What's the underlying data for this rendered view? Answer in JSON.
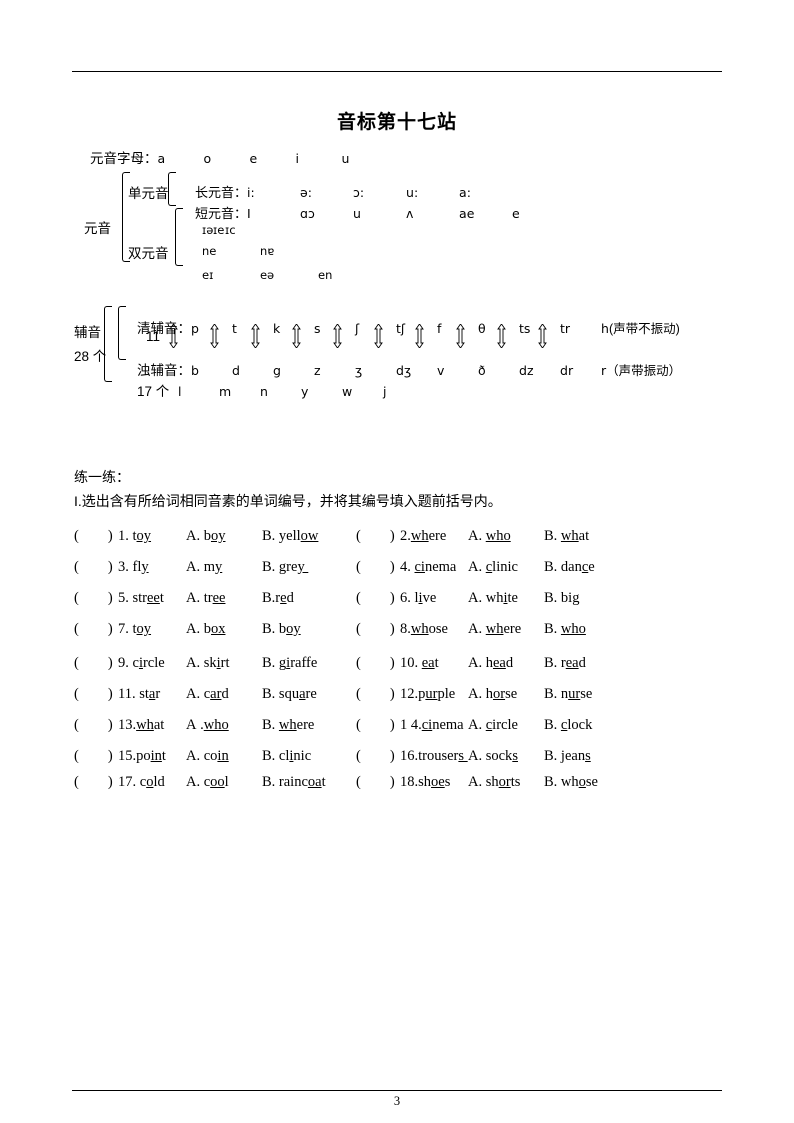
{
  "document": {
    "title": "音标第十七站",
    "page_number": "3"
  },
  "vowel_letters": {
    "label": "元音字母：",
    "letters": [
      "a",
      "o",
      "e",
      "i",
      "u"
    ]
  },
  "vowel_tree": {
    "root_label": "元音",
    "monophthong_label": "单元音",
    "diphthong_label": "双元音",
    "long_label": "长元音：",
    "short_label": "短元音：",
    "long_vowels": [
      "i:",
      "ə:",
      "ɔ:",
      "u:",
      "a:"
    ],
    "short_vowels": [
      "I",
      "ɑɔ",
      "u",
      "ʌ",
      "ae",
      "e"
    ],
    "diphthongs_row1": [
      "eɪ",
      "əɪ",
      "ɔɪ"
    ],
    "diphthongs_row2": [
      "əu",
      "au"
    ],
    "diphthongs_row3": [
      "ɪə",
      "eə",
      "uə"
    ]
  },
  "consonants": {
    "root_label": "辅音",
    "count_label": "28 个",
    "voiceless_label": "清辅音：",
    "voiceless_count": "11",
    "voiced_label": "浊辅音：",
    "voiced_count": "17 个",
    "voiceless": [
      "p",
      "t",
      "k",
      "s",
      "ʃ",
      "tʃ",
      "f",
      "θ",
      "ts",
      "tr"
    ],
    "voiceless_extra": "h",
    "voiceless_note": "(声带不振动)",
    "voiced": [
      "b",
      "d",
      "g",
      "z",
      "ʒ",
      "dʒ",
      "v",
      "ð",
      "dz",
      "dr"
    ],
    "voiced_extra": "r",
    "voiced_note": "（声带振动）",
    "nasals_liquids": [
      "l",
      "m",
      "n",
      "y",
      "w",
      "j"
    ]
  },
  "practice": {
    "heading": "练一练：",
    "instruction": "I.选出含有所给词相同音素的单词编号，并将其编号填入题前括号内。",
    "paren": "(        )",
    "items": [
      {
        "num": "1. ",
        "word_pre": "t",
        "word_u": "oy",
        "word_post": " ",
        "a_pre": "A. b",
        "a_u": "oy",
        "a_post": "",
        "b_pre": "B. yell",
        "b_u": "ow",
        "b_post": ""
      },
      {
        "num": "2.",
        "word_pre": "",
        "word_u": "wh",
        "word_post": "ere",
        "a_pre": "A. ",
        "a_u": "who",
        "a_post": "",
        "b_pre": "B. ",
        "b_u": "wh",
        "b_post": "at"
      },
      {
        "num": "3. fl",
        "word_pre": "",
        "word_u": "y",
        "word_post": "",
        "a_pre": "A. m",
        "a_u": "y",
        "a_post": "",
        "b_pre": "B. gre",
        "b_u": "y ",
        "b_post": ""
      },
      {
        "num": "4. ",
        "word_pre": "",
        "word_u": "ci",
        "word_post": "nema",
        "a_pre": "A. ",
        "a_u": "c",
        "a_post": "linic",
        "b_pre": "B. dan",
        "b_u": "c",
        "b_post": "e"
      },
      {
        "num": "5. str",
        "word_pre": "",
        "word_u": "ee",
        "word_post": "t",
        "a_pre": "A. tr",
        "a_u": "ee",
        "a_post": "",
        "b_pre": "B.r",
        "b_u": "e",
        "b_post": "d"
      },
      {
        "num": "6. l",
        "word_pre": "",
        "word_u": "i",
        "word_post": "ve",
        "a_pre": "A. wh",
        "a_u": "i",
        "a_post": "te",
        "b_pre": "B. bi",
        "b_u": "g",
        "b_post": ""
      },
      {
        "num": "7. t",
        "word_pre": "",
        "word_u": "oy",
        "word_post": "",
        "a_pre": "A. b",
        "a_u": "ox",
        "a_post": "",
        "b_pre": "B. b",
        "b_u": "oy",
        "b_post": ""
      },
      {
        "num": "8.",
        "word_pre": "",
        "word_u": "wh",
        "word_post": "ose",
        "a_pre": "A. ",
        "a_u": "wh",
        "a_post": "ere",
        "b_pre": "B. ",
        "b_u": "who",
        "b_post": ""
      },
      {
        "num": "9. c",
        "word_pre": "",
        "word_u": "i",
        "word_post": "rcle",
        "a_pre": "A. sk",
        "a_u": "i",
        "a_post": "rt",
        "b_pre": "B. g",
        "b_u": "i",
        "b_post": "raffe"
      },
      {
        "num": "10. ",
        "word_pre": "",
        "word_u": "ea",
        "word_post": "t",
        "a_pre": "A. h",
        "a_u": "ea",
        "a_post": "d",
        "b_pre": "B. r",
        "b_u": "ea",
        "b_post": "d"
      },
      {
        "num": "11. st",
        "word_pre": "",
        "word_u": "a",
        "word_post": "r",
        "a_pre": "A. c",
        "a_u": "ar",
        "a_post": "d",
        "b_pre": "B. squ",
        "b_u": "a",
        "b_post": "re"
      },
      {
        "num": "12.p",
        "word_pre": "",
        "word_u": "ur",
        "word_post": "ple",
        "a_pre": "A. h",
        "a_u": "or",
        "a_post": "se",
        "b_pre": "B. n",
        "b_u": "ur",
        "b_post": "se"
      },
      {
        "num": "13.",
        "word_pre": "",
        "word_u": "wh",
        "word_post": "at",
        "a_pre": "A .",
        "a_u": "who",
        "a_post": "",
        "b_pre": "B. ",
        "b_u": "wh",
        "b_post": "ere"
      },
      {
        "num": "1 4.",
        "word_pre": "",
        "word_u": "ci",
        "word_post": "nema",
        "a_pre": "A. ",
        "a_u": "c",
        "a_post": "ircle",
        "b_pre": "B. ",
        "b_u": "c",
        "b_post": "lock"
      },
      {
        "num": "15.po",
        "word_pre": "",
        "word_u": "in",
        "word_post": "t",
        "a_pre": "A. co",
        "a_u": "in",
        "a_post": "",
        "b_pre": "B. cl",
        "b_u": "i",
        "b_post": "nic"
      },
      {
        "num": "16.trouser",
        "word_pre": "",
        "word_u": "s ",
        "word_post": "",
        "a_pre": "A. sock",
        "a_u": "s",
        "a_post": "",
        "b_pre": "B. jean",
        "b_u": "s",
        "b_post": ""
      },
      {
        "num": "17. c",
        "word_pre": "",
        "word_u": "o",
        "word_post": "ld",
        "a_pre": "A. c",
        "a_u": "oo",
        "a_post": "l",
        "b_pre": "B. rainc",
        "b_u": "oa",
        "b_post": "t"
      },
      {
        "num": "18.sh",
        "word_pre": "",
        "word_u": "oe",
        "word_post": "s",
        "a_pre": "A. sh",
        "a_u": "or",
        "a_post": "ts",
        "b_pre": "B. wh",
        "b_u": "o",
        "b_post": "se"
      }
    ]
  }
}
